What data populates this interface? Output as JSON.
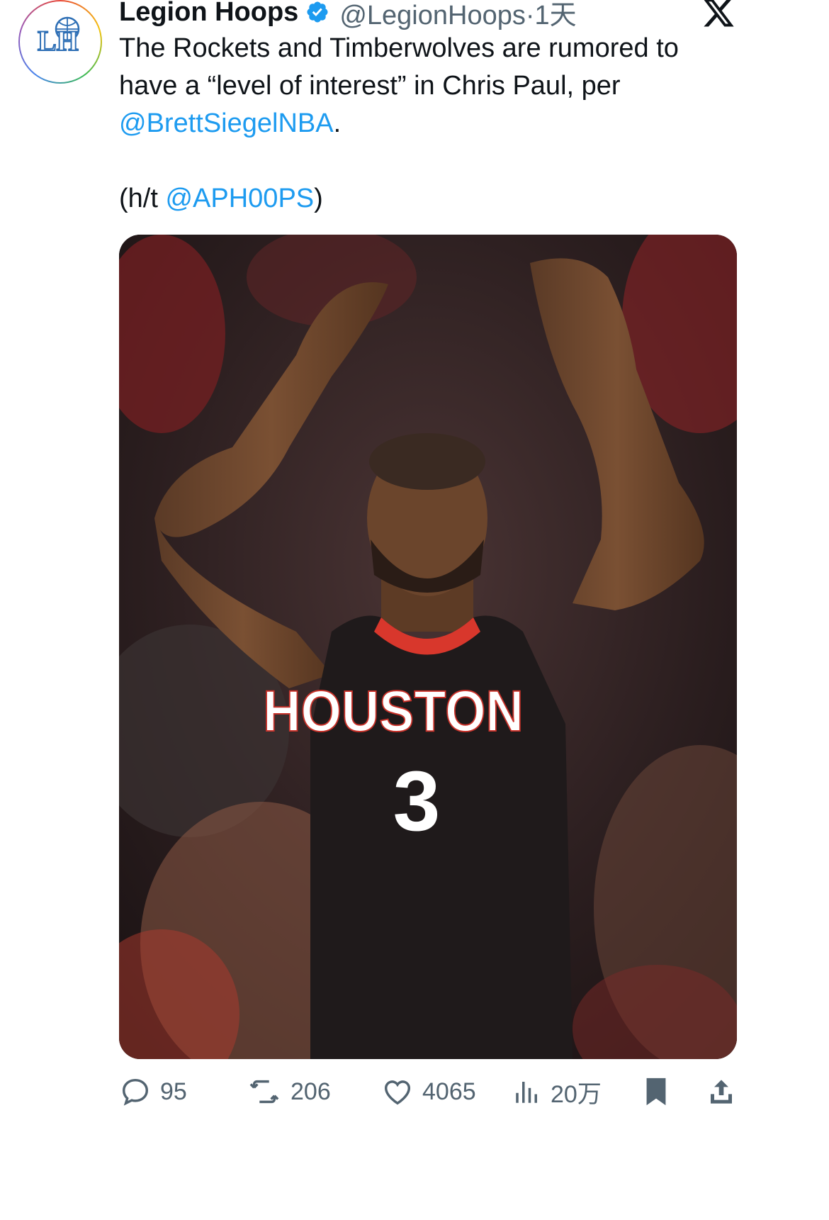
{
  "author": {
    "display_name": "Legion Hoops",
    "handle": "@LegionHoops",
    "separator": "·",
    "time_ago": "1天",
    "avatar_initials": "LH"
  },
  "tweet": {
    "line1": "The Rockets and Timberwolves are rumored to",
    "line2": "have a “level of interest” in Chris Paul, per",
    "mention1": "@BrettSiegelNBA",
    "period": ".",
    "ht_prefix": "(h/t ",
    "mention2": "@APH00PS",
    "ht_suffix": ")"
  },
  "media": {
    "jersey_text": "HOUSTON",
    "jersey_number": "3"
  },
  "actions": {
    "replies": "95",
    "retweets": "206",
    "likes": "4065",
    "views": "20万"
  },
  "colors": {
    "link": "#1d9bf0",
    "secondary_text": "#536471",
    "verified": "#1d9bf0"
  }
}
